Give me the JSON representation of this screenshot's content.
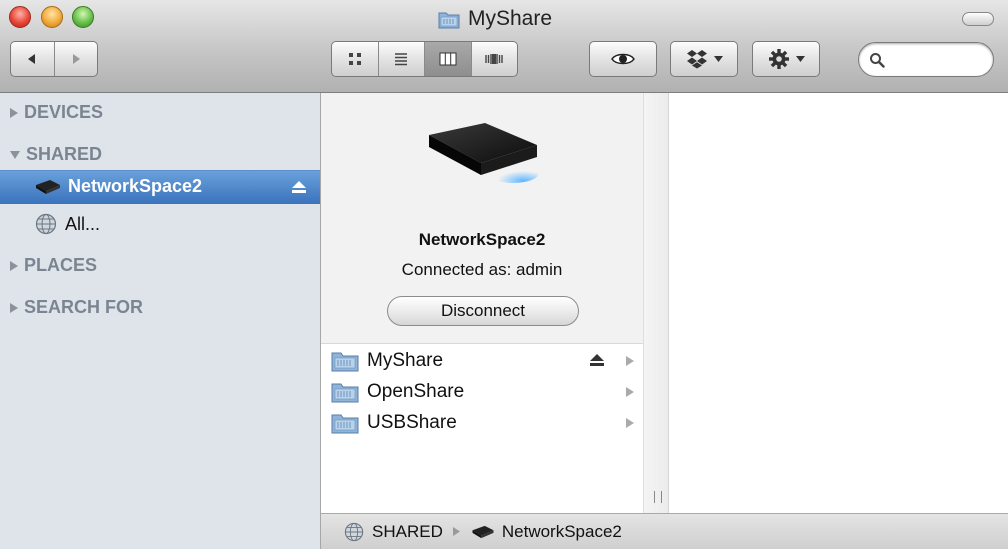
{
  "window": {
    "title": "MyShare"
  },
  "toolbar": {
    "back": "chevron-left-icon",
    "forward": "chevron-right-icon",
    "view_modes": [
      "icon-view",
      "list-view",
      "column-view",
      "coverflow-view"
    ],
    "active_view": "column-view",
    "quicklook": "eye-icon",
    "dropbox": "dropbox-icon",
    "action": "gear-icon",
    "search_value": ""
  },
  "sidebar": {
    "sections": {
      "devices": "DEVICES",
      "shared": "SHARED",
      "places": "PLACES",
      "search_for": "SEARCH FOR"
    },
    "shared_items": [
      {
        "label": "NetworkSpace2",
        "selected": true
      },
      {
        "label": "All...",
        "selected": false
      }
    ]
  },
  "info": {
    "device_name": "NetworkSpace2",
    "connected_as": "Connected as: admin",
    "disconnect_label": "Disconnect"
  },
  "shares": [
    {
      "label": "MyShare",
      "ejectable": true
    },
    {
      "label": "OpenShare",
      "ejectable": false
    },
    {
      "label": "USBShare",
      "ejectable": false
    }
  ],
  "pathbar": {
    "root": "SHARED",
    "device": "NetworkSpace2"
  },
  "colors": {
    "selection": "#3b73bd",
    "sidebar_bg": "#dfe4ea",
    "section_text": "#7b8592"
  }
}
